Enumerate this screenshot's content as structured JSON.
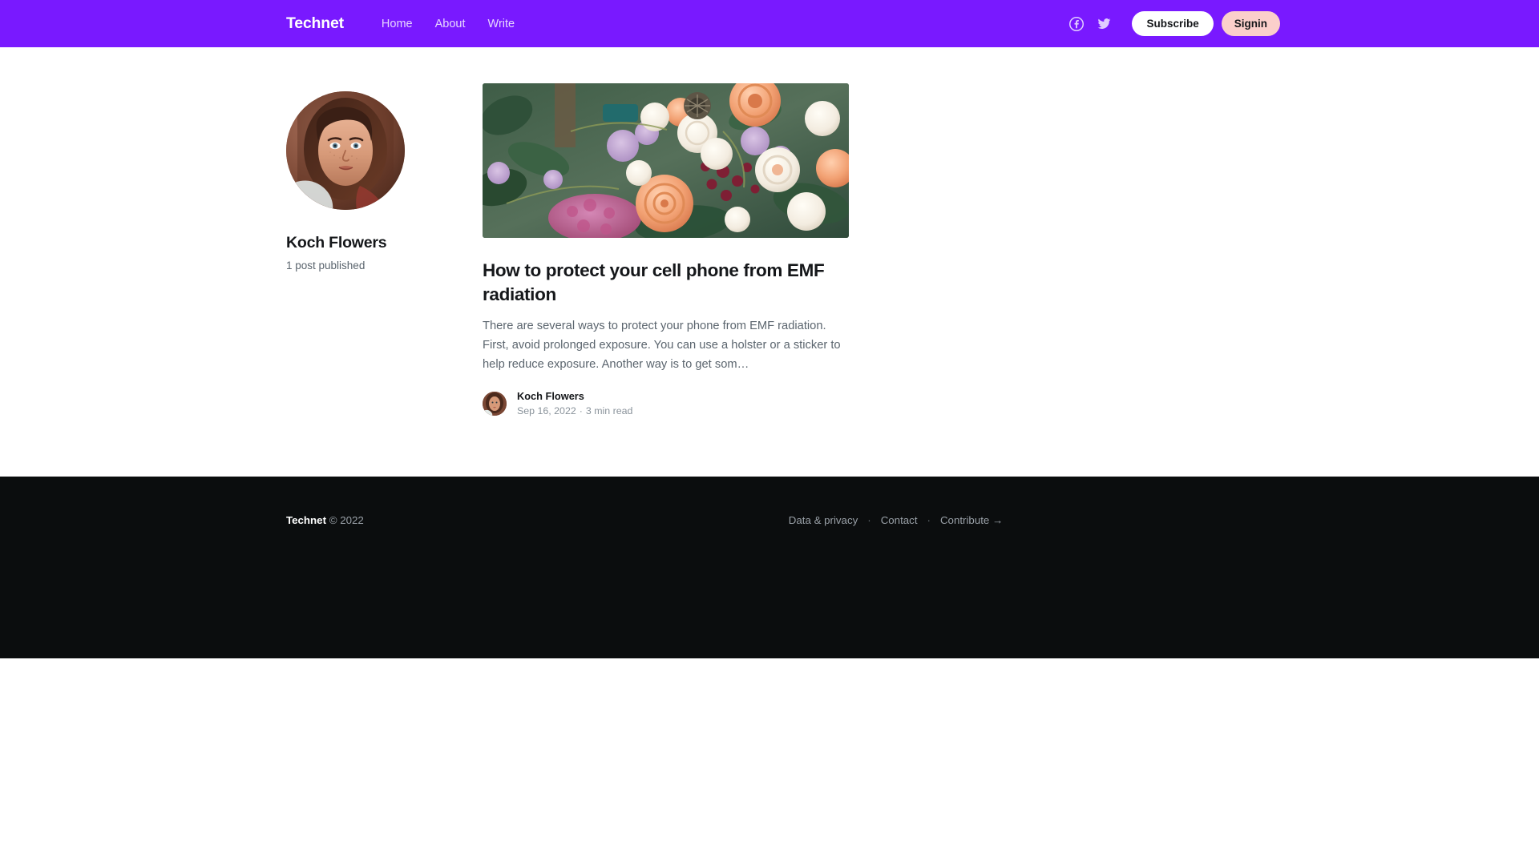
{
  "header": {
    "brand": "Technet",
    "nav": [
      {
        "label": "Home",
        "name": "nav-home"
      },
      {
        "label": "About",
        "name": "nav-about"
      },
      {
        "label": "Write",
        "name": "nav-write"
      }
    ],
    "social": [
      {
        "icon": "facebook-icon"
      },
      {
        "icon": "twitter-icon"
      }
    ],
    "subscribe_label": "Subscribe",
    "signin_label": "Signin",
    "colors": {
      "background": "#7919ff",
      "nav_link": "#e7d6ff",
      "subscribe_bg": "#ffffff",
      "signin_bg": "#fbcfcb"
    }
  },
  "author": {
    "avatar_alt": "Koch Flowers portrait",
    "name": "Koch Flowers",
    "post_count": "1 post published"
  },
  "post": {
    "image_alt": "Flower bouquet with roses and greenery",
    "title": "How to protect your cell phone from EMF radiation",
    "excerpt": "There are several ways to protect your phone from EMF radiation. First, avoid prolonged exposure. You can use a holster or a sticker to help reduce exposure. Another way is to get som…",
    "meta": {
      "author": "Koch Flowers",
      "date": "Sep 16, 2022",
      "separator": "·",
      "read_time": "3 min read"
    }
  },
  "footer": {
    "brand": "Technet",
    "copyright": "© 2022",
    "links": [
      {
        "label": "Data & privacy"
      },
      {
        "label": "Contact"
      },
      {
        "label": "Contribute →"
      }
    ],
    "separator": "·",
    "background": "#0b0d0e"
  }
}
